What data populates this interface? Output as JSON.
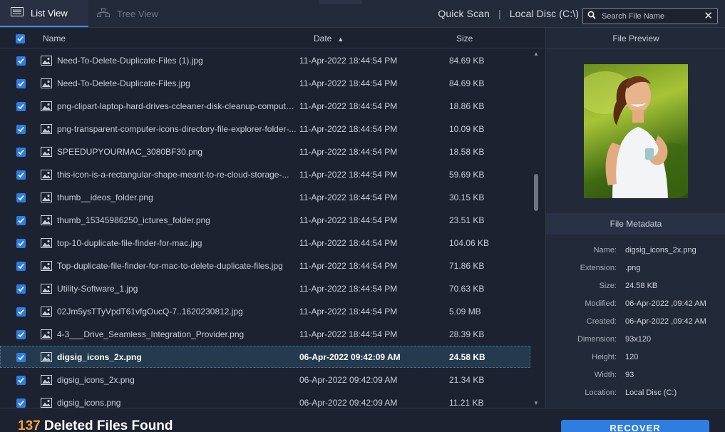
{
  "tabs": [
    {
      "label": "List View",
      "active": true
    },
    {
      "label": "Tree View",
      "active": false
    }
  ],
  "header_right": {
    "scan_type": "Quick Scan",
    "separator": "|",
    "location": "Local Disc (C:\\)"
  },
  "search": {
    "placeholder": "Search File Name"
  },
  "columns": {
    "name": "Name",
    "date": "Date",
    "size": "Size"
  },
  "files": [
    {
      "name": "Need-To-Delete-Duplicate-Files (1).jpg",
      "date": "11-Apr-2022 18:44:54 PM",
      "size": "84.69 KB"
    },
    {
      "name": "Need-To-Delete-Duplicate-Files.jpg",
      "date": "11-Apr-2022 18:44:54 PM",
      "size": "84.69 KB"
    },
    {
      "name": "png-clipart-laptop-hard-drives-ccleaner-disk-cleanup-computer-...",
      "date": "11-Apr-2022 18:44:54 PM",
      "size": "18.86 KB"
    },
    {
      "name": "png-transparent-computer-icons-directory-file-explorer-folder-...",
      "date": "11-Apr-2022 18:44:54 PM",
      "size": "10.09 KB"
    },
    {
      "name": "SPEEDUPYOURMAC_3080BF30.png",
      "date": "11-Apr-2022 18:44:54 PM",
      "size": "18.58 KB"
    },
    {
      "name": "this-icon-is-a-rectangular-shape-meant-to-re-cloud-storage-...",
      "date": "11-Apr-2022 18:44:54 PM",
      "size": "59.69 KB"
    },
    {
      "name": "thumb__ideos_folder.png",
      "date": "11-Apr-2022 18:44:54 PM",
      "size": "30.15 KB"
    },
    {
      "name": "thumb_15345986250_ictures_folder.png",
      "date": "11-Apr-2022 18:44:54 PM",
      "size": "23.51 KB"
    },
    {
      "name": "top-10-duplicate-file-finder-for-mac.jpg",
      "date": "11-Apr-2022 18:44:54 PM",
      "size": "104.06 KB"
    },
    {
      "name": "Top-duplicate-file-finder-for-mac-to-delete-duplicate-files.jpg",
      "date": "11-Apr-2022 18:44:54 PM",
      "size": "71.86 KB"
    },
    {
      "name": "Utility-Software_1.jpg",
      "date": "11-Apr-2022 18:44:54 PM",
      "size": "70.63 KB"
    },
    {
      "name": "02Jm5ysTTyVpdT61vfgOucQ-7..1620230812.jpg",
      "date": "11-Apr-2022 18:44:54 PM",
      "size": "5.09 MB"
    },
    {
      "name": "4-3___Drive_Seamless_Integration_Provider.png",
      "date": "11-Apr-2022 18:44:54 PM",
      "size": "28.39 KB"
    },
    {
      "name": "digsig_icons_2x.png",
      "date": "06-Apr-2022 09:42:09 AM",
      "size": "24.58 KB",
      "selected": true
    },
    {
      "name": "digsig_icons_2x.png",
      "date": "06-Apr-2022 09:42:09 AM",
      "size": "21.34 KB"
    },
    {
      "name": "digsig_icons.png",
      "date": "06-Apr-2022 09:42:09 AM",
      "size": "11.21 KB"
    }
  ],
  "preview": {
    "title": "File Preview"
  },
  "metadata": {
    "title": "File Metadata",
    "fields": [
      {
        "label": "Name:",
        "value": "digsig_icons_2x.png"
      },
      {
        "label": "Extension:",
        "value": ".png"
      },
      {
        "label": "Size:",
        "value": "24.58 KB"
      },
      {
        "label": "Modified:",
        "value": "06-Apr-2022 ,09:42 AM"
      },
      {
        "label": "Created:",
        "value": "06-Apr-2022 ,09:42 AM"
      },
      {
        "label": "Dimension:",
        "value": "93x120"
      },
      {
        "label": "Height:",
        "value": "120"
      },
      {
        "label": "Width:",
        "value": "93"
      },
      {
        "label": "Location:",
        "value": "Local Disc (C:)"
      }
    ]
  },
  "footer": {
    "count": "137",
    "label": "Deleted Files Found",
    "recover_label": "RECOVER"
  },
  "colors": {
    "accent": "#2f7de1",
    "count": "#f0a23a",
    "background": "#1c2230"
  }
}
